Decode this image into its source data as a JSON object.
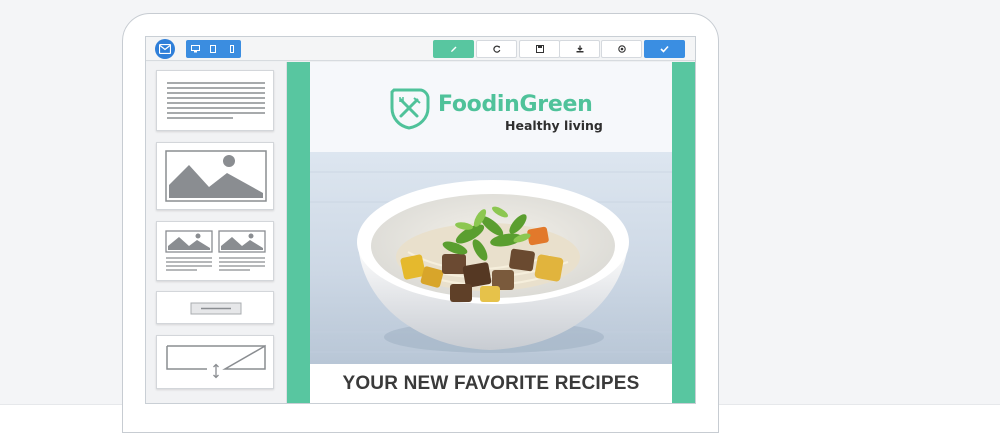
{
  "brand": {
    "name": "FoodinGreen",
    "tagline": "Healthy living"
  },
  "email": {
    "headline": "YOUR NEW FAVORITE RECIPES"
  },
  "toolbar": {
    "view_modes": [
      "desktop-icon",
      "tablet-icon",
      "mobile-icon"
    ],
    "actions": [
      "edit-icon",
      "refresh-icon",
      "save-icon",
      "download-icon",
      "preview-icon",
      "check-icon"
    ]
  },
  "blocks": [
    "text-block",
    "image-block",
    "two-images-text-block",
    "button-block",
    "spacer-block"
  ],
  "colors": {
    "accent_green": "#58c6a0",
    "accent_blue": "#3a8ee2",
    "headline_text": "#3a3a3a",
    "page_bg": "#f4f5f7"
  }
}
